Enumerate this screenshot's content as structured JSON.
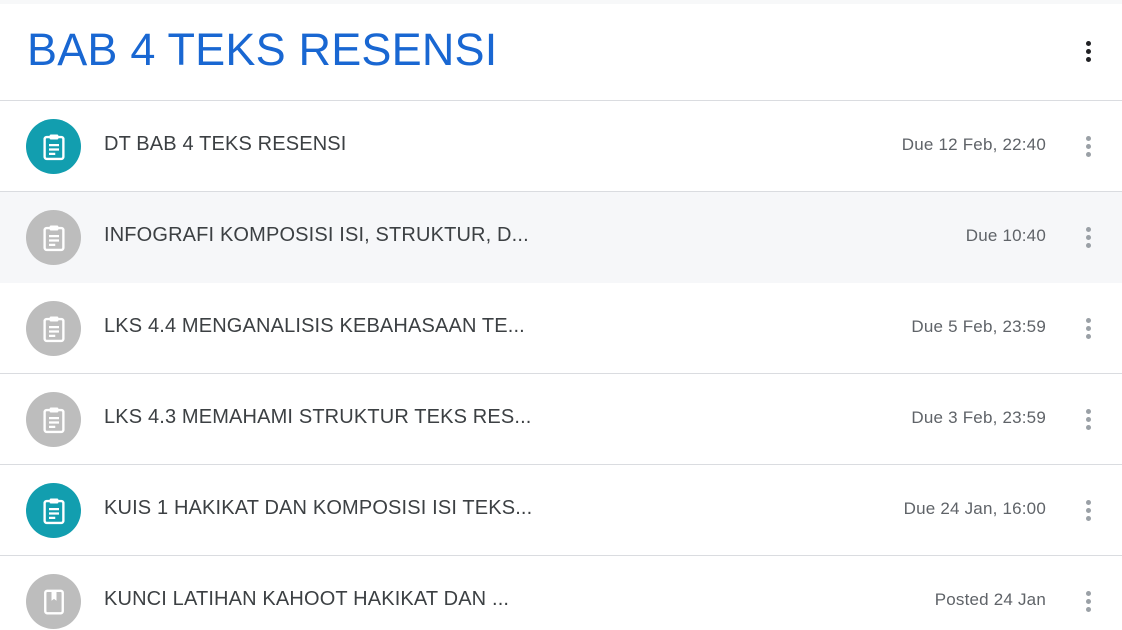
{
  "topic": {
    "title": "BAB 4 TEKS RESENSI"
  },
  "colors": {
    "accent": "#1967d2",
    "active_icon": "#129eaf",
    "inactive_icon": "#bdbdbd",
    "text": "#3c4043",
    "secondary_text": "#5f6368"
  },
  "items": [
    {
      "title": "DT BAB 4 TEKS RESENSI",
      "date": "Due 12 Feb, 22:40",
      "icon": "assignment-icon",
      "state": "active"
    },
    {
      "title": "INFOGRAFI KOMPOSISI ISI, STRUKTUR, D...",
      "date": "Due 10:40",
      "icon": "assignment-icon",
      "state": "inactive"
    },
    {
      "title": "LKS 4.4 MENGANALISIS KEBAHASAAN TE...",
      "date": "Due 5 Feb, 23:59",
      "icon": "assignment-icon",
      "state": "inactive"
    },
    {
      "title": "LKS 4.3 MEMAHAMI STRUKTUR TEKS RES...",
      "date": "Due 3 Feb, 23:59",
      "icon": "assignment-icon",
      "state": "inactive"
    },
    {
      "title": "KUIS 1 HAKIKAT DAN KOMPOSISI ISI TEKS...",
      "date": "Due 24 Jan, 16:00",
      "icon": "assignment-icon",
      "state": "active"
    },
    {
      "title": "KUNCI LATIHAN KAHOOT HAKIKAT DAN ...",
      "date": "Posted 24 Jan",
      "icon": "material-icon",
      "state": "inactive"
    }
  ]
}
